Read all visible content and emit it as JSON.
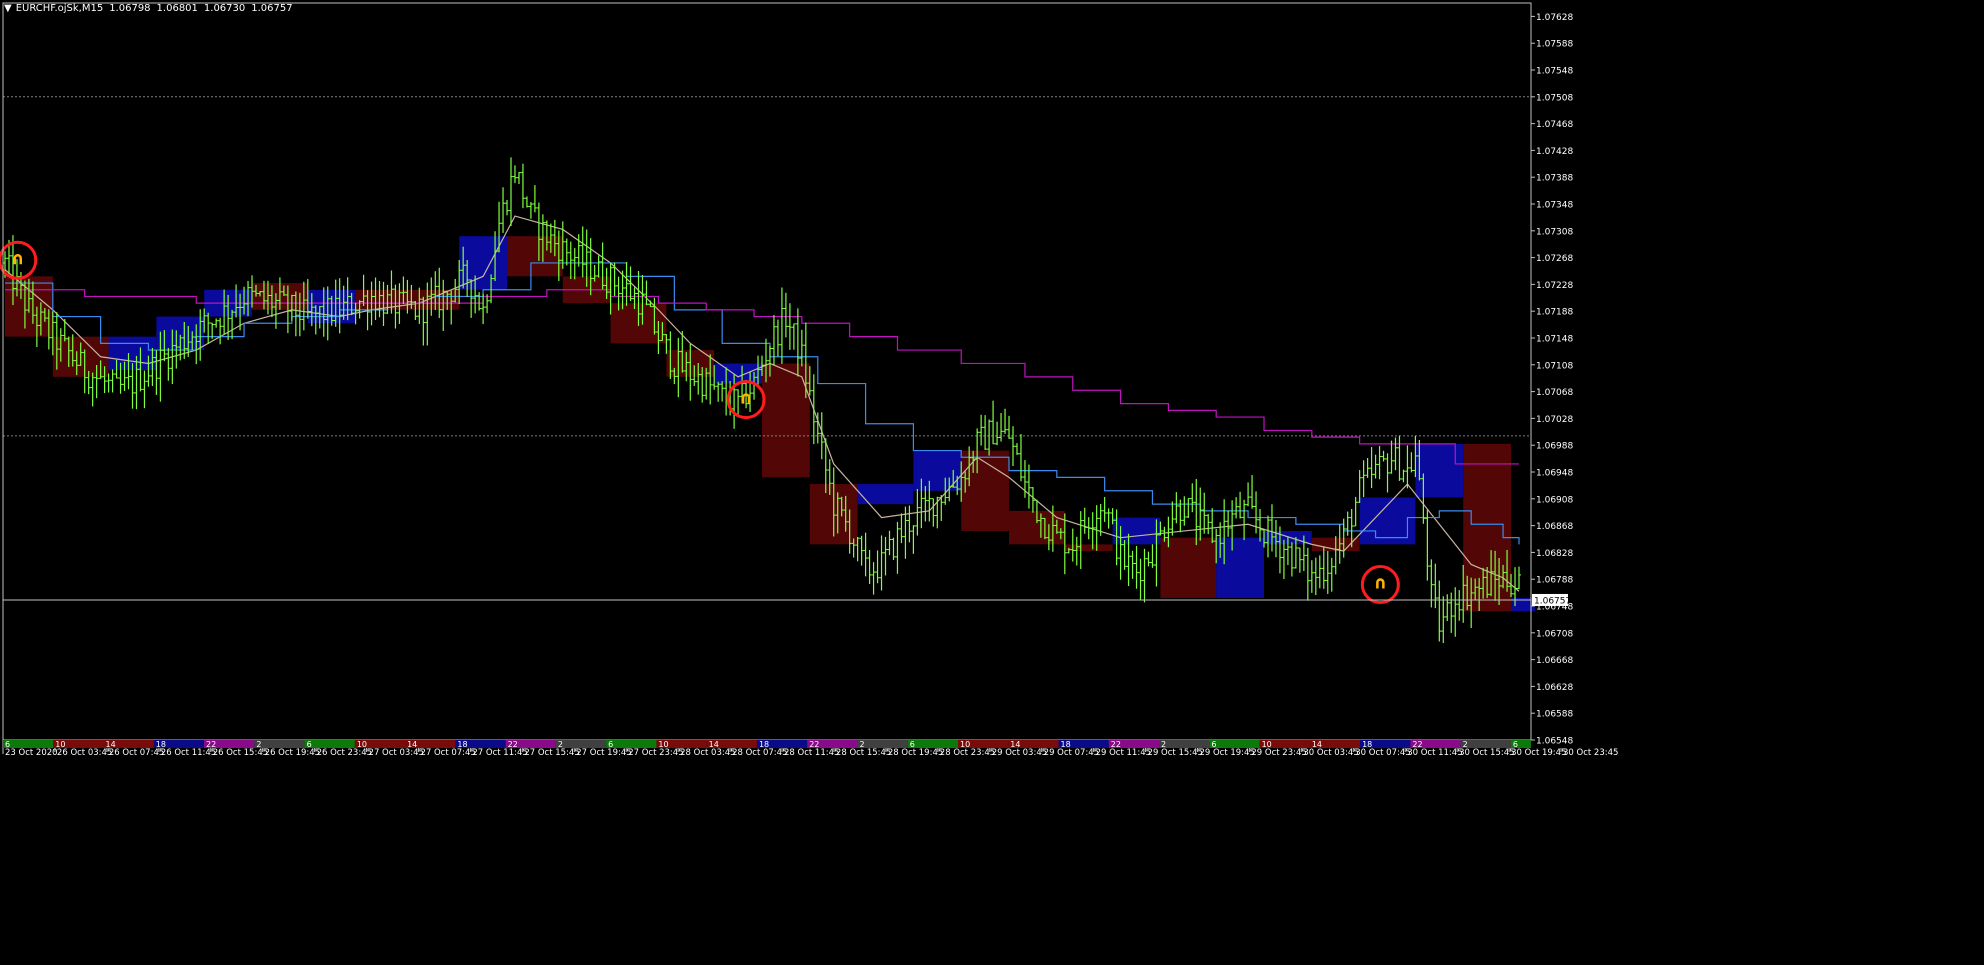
{
  "header": {
    "symbol": "EURCHF.ojSk,M15",
    "open": "1.06798",
    "high": "1.06801",
    "low": "1.06730",
    "close": "1.06757",
    "menu_icon": "triangle-down-icon"
  },
  "colors": {
    "background": "#000000",
    "frame": "#c0c0c0",
    "candle": "#7fff3f",
    "session_up": "#0a0a9c",
    "session_down": "#520606",
    "ma_fast": "#c8b4a0",
    "ma_mid": "#3a8cf0",
    "ma_slow": "#c012c0",
    "marker_circle": "#ff1c1c",
    "marker_icon": "#ffb400",
    "price_line": "#c0c0c0",
    "level_line": "#808080"
  },
  "chart_data": {
    "type": "candlestick",
    "symbol": "EURCHF.ojSk",
    "timeframe": "M15",
    "ylim": [
      1.06548,
      1.07648
    ],
    "y_ticks": [
      "1.07628",
      "1.07588",
      "1.07548",
      "1.07508",
      "1.07468",
      "1.07428",
      "1.07388",
      "1.07348",
      "1.07308",
      "1.07268",
      "1.07228",
      "1.07188",
      "1.07148",
      "1.07108",
      "1.07068",
      "1.07028",
      "1.06988",
      "1.06948",
      "1.06908",
      "1.06868",
      "1.06828",
      "1.06788",
      "1.06748",
      "1.06708",
      "1.06668",
      "1.06628",
      "1.06588",
      "1.06548"
    ],
    "x_ticks": [
      "23 Oct 2020",
      "26 Oct 03:45",
      "26 Oct 07:45",
      "26 Oct 11:45",
      "26 Oct 15:45",
      "26 Oct 19:45",
      "26 Oct 23:45",
      "27 Oct 03:45",
      "27 Oct 07:45",
      "27 Oct 11:45",
      "27 Oct 15:45",
      "27 Oct 19:45",
      "27 Oct 23:45",
      "28 Oct 03:45",
      "28 Oct 07:45",
      "28 Oct 11:45",
      "28 Oct 15:45",
      "28 Oct 19:45",
      "28 Oct 23:45",
      "29 Oct 03:45",
      "29 Oct 07:45",
      "29 Oct 11:45",
      "29 Oct 15:45",
      "29 Oct 19:45",
      "29 Oct 23:45",
      "30 Oct 03:45",
      "30 Oct 07:45",
      "30 Oct 11:45",
      "30 Oct 15:45",
      "30 Oct 19:45",
      "30 Oct 23:45"
    ],
    "current_price": "1.06757",
    "horizontal_levels": [
      1.07508,
      1.07002
    ],
    "price_path": [
      [
        0,
        1.0726
      ],
      [
        1.5,
        1.0719
      ],
      [
        3,
        1.0715
      ],
      [
        5,
        1.071
      ],
      [
        7,
        1.0707
      ],
      [
        8,
        1.0708
      ],
      [
        10,
        1.0712
      ],
      [
        12,
        1.0716
      ],
      [
        14,
        1.0719
      ],
      [
        15,
        1.0721
      ],
      [
        17,
        1.072
      ],
      [
        19,
        1.0718
      ],
      [
        21,
        1.0719
      ],
      [
        23,
        1.0721
      ],
      [
        24,
        1.072
      ],
      [
        26,
        1.0719
      ],
      [
        27.5,
        1.0721
      ],
      [
        29,
        1.0724
      ],
      [
        30,
        1.0719
      ],
      [
        31,
        1.0732
      ],
      [
        32,
        1.074
      ],
      [
        33,
        1.0733
      ],
      [
        34,
        1.073
      ],
      [
        35,
        1.0728
      ],
      [
        37,
        1.0725
      ],
      [
        39,
        1.0722
      ],
      [
        40,
        1.072
      ],
      [
        41,
        1.0715
      ],
      [
        42,
        1.0711
      ],
      [
        44,
        1.0708
      ],
      [
        45,
        1.0706
      ],
      [
        46,
        1.0705
      ],
      [
        47,
        1.0708
      ],
      [
        48,
        1.0714
      ],
      [
        49,
        1.0718
      ],
      [
        50,
        1.0712
      ],
      [
        51,
        1.07
      ],
      [
        52,
        1.069
      ],
      [
        53,
        1.0686
      ],
      [
        54,
        1.068
      ],
      [
        55,
        1.0681
      ],
      [
        56,
        1.0685
      ],
      [
        57,
        1.0688
      ],
      [
        58,
        1.069
      ],
      [
        59,
        1.0692
      ],
      [
        60,
        1.0694
      ],
      [
        61,
        1.0699
      ],
      [
        62,
        1.0701
      ],
      [
        63,
        1.07
      ],
      [
        64,
        1.0693
      ],
      [
        65,
        1.0688
      ],
      [
        66,
        1.0685
      ],
      [
        67,
        1.0684
      ],
      [
        68,
        1.0688
      ],
      [
        69,
        1.069
      ],
      [
        70,
        1.0682
      ],
      [
        71,
        1.068
      ],
      [
        72,
        1.0683
      ],
      [
        73,
        1.0688
      ],
      [
        74,
        1.069
      ],
      [
        75,
        1.0687
      ],
      [
        76,
        1.0685
      ],
      [
        77,
        1.0688
      ],
      [
        78,
        1.0689
      ],
      [
        79,
        1.0686
      ],
      [
        80,
        1.0684
      ],
      [
        81,
        1.0682
      ],
      [
        82,
        1.0679
      ],
      [
        83,
        1.0681
      ],
      [
        84,
        1.0685
      ],
      [
        85,
        1.0692
      ],
      [
        86,
        1.0695
      ],
      [
        87,
        1.0697
      ],
      [
        88,
        1.0695
      ],
      [
        88.5,
        1.0697
      ],
      [
        89,
        1.0688
      ],
      [
        89.5,
        1.0676
      ],
      [
        90,
        1.0672
      ],
      [
        91,
        1.0676
      ],
      [
        92,
        1.0677
      ],
      [
        93,
        1.0678
      ],
      [
        94,
        1.0679
      ],
      [
        95,
        1.0678
      ]
    ],
    "series": [
      {
        "name": "ma_fast",
        "points": [
          [
            0,
            1.0725
          ],
          [
            3,
            1.0719
          ],
          [
            6,
            1.0712
          ],
          [
            9,
            1.0711
          ],
          [
            12,
            1.0713
          ],
          [
            15,
            1.0717
          ],
          [
            18,
            1.0719
          ],
          [
            21,
            1.0718
          ],
          [
            23,
            1.0719
          ],
          [
            26,
            1.072
          ],
          [
            28,
            1.0722
          ],
          [
            30,
            1.0724
          ],
          [
            32,
            1.0733
          ],
          [
            35,
            1.0731
          ],
          [
            38,
            1.0726
          ],
          [
            41,
            1.0719
          ],
          [
            43,
            1.0714
          ],
          [
            46,
            1.0709
          ],
          [
            48,
            1.0711
          ],
          [
            50,
            1.0709
          ],
          [
            52,
            1.0696
          ],
          [
            55,
            1.0688
          ],
          [
            58,
            1.0689
          ],
          [
            61,
            1.0697
          ],
          [
            63,
            1.0694
          ],
          [
            66,
            1.0688
          ],
          [
            70,
            1.0685
          ],
          [
            74,
            1.0686
          ],
          [
            78,
            1.0687
          ],
          [
            82,
            1.0684
          ],
          [
            84,
            1.0683
          ],
          [
            86,
            1.0688
          ],
          [
            88,
            1.0693
          ],
          [
            90,
            1.0687
          ],
          [
            92,
            1.0681
          ],
          [
            94,
            1.0679
          ],
          [
            95,
            1.0677
          ]
        ]
      },
      {
        "name": "ma_mid",
        "points": [
          [
            0,
            1.0723
          ],
          [
            3,
            1.0718
          ],
          [
            6,
            1.0714
          ],
          [
            9,
            1.0713
          ],
          [
            12,
            1.0715
          ],
          [
            15,
            1.0717
          ],
          [
            18,
            1.0718
          ],
          [
            21,
            1.0719
          ],
          [
            24,
            1.072
          ],
          [
            27,
            1.0721
          ],
          [
            30,
            1.0722
          ],
          [
            33,
            1.0726
          ],
          [
            36,
            1.0726
          ],
          [
            39,
            1.0724
          ],
          [
            42,
            1.0719
          ],
          [
            45,
            1.0714
          ],
          [
            48,
            1.0712
          ],
          [
            51,
            1.0708
          ],
          [
            54,
            1.0702
          ],
          [
            57,
            1.0698
          ],
          [
            60,
            1.0697
          ],
          [
            63,
            1.0695
          ],
          [
            66,
            1.0694
          ],
          [
            69,
            1.0692
          ],
          [
            72,
            1.069
          ],
          [
            75,
            1.0689
          ],
          [
            78,
            1.0688
          ],
          [
            81,
            1.0687
          ],
          [
            84,
            1.0686
          ],
          [
            86,
            1.0685
          ],
          [
            88,
            1.0688
          ],
          [
            90,
            1.0689
          ],
          [
            92,
            1.0687
          ],
          [
            94,
            1.0685
          ],
          [
            95,
            1.0684
          ]
        ]
      },
      {
        "name": "ma_slow",
        "points": [
          [
            0,
            1.0722
          ],
          [
            5,
            1.0721
          ],
          [
            12,
            1.072
          ],
          [
            20,
            1.072
          ],
          [
            26,
            1.072
          ],
          [
            30,
            1.0721
          ],
          [
            34,
            1.0722
          ],
          [
            38,
            1.0721
          ],
          [
            41,
            1.072
          ],
          [
            44,
            1.0719
          ],
          [
            47,
            1.0718
          ],
          [
            50,
            1.0717
          ],
          [
            53,
            1.0715
          ],
          [
            56,
            1.0713
          ],
          [
            60,
            1.0711
          ],
          [
            64,
            1.0709
          ],
          [
            67,
            1.0707
          ],
          [
            70,
            1.0705
          ],
          [
            73,
            1.0704
          ],
          [
            76,
            1.0703
          ],
          [
            79,
            1.0701
          ],
          [
            82,
            1.07
          ],
          [
            85,
            1.0699
          ],
          [
            88,
            1.0699
          ],
          [
            91,
            1.0696
          ],
          [
            95,
            1.0696
          ]
        ]
      }
    ],
    "session_boxes": [
      {
        "x0": 0,
        "x1": 3,
        "top": 1.0724,
        "bottom": 1.0715,
        "dir": "down"
      },
      {
        "x0": 3,
        "x1": 6.5,
        "top": 1.0715,
        "bottom": 1.0709,
        "dir": "down"
      },
      {
        "x0": 6.5,
        "x1": 9.5,
        "top": 1.0715,
        "bottom": 1.071,
        "dir": "up"
      },
      {
        "x0": 9.5,
        "x1": 12.5,
        "top": 1.0718,
        "bottom": 1.0713,
        "dir": "up"
      },
      {
        "x0": 12.5,
        "x1": 15.5,
        "top": 1.0722,
        "bottom": 1.0718,
        "dir": "up"
      },
      {
        "x0": 15.5,
        "x1": 19,
        "top": 1.0723,
        "bottom": 1.0719,
        "dir": "down"
      },
      {
        "x0": 19,
        "x1": 22,
        "top": 1.0722,
        "bottom": 1.0717,
        "dir": "up"
      },
      {
        "x0": 22,
        "x1": 25,
        "top": 1.0722,
        "bottom": 1.0719,
        "dir": "down"
      },
      {
        "x0": 25,
        "x1": 28.5,
        "top": 1.0722,
        "bottom": 1.0719,
        "dir": "down"
      },
      {
        "x0": 28.5,
        "x1": 31.5,
        "top": 1.073,
        "bottom": 1.0722,
        "dir": "up"
      },
      {
        "x0": 31.5,
        "x1": 35,
        "top": 1.073,
        "bottom": 1.0724,
        "dir": "down"
      },
      {
        "x0": 35,
        "x1": 38,
        "top": 1.0724,
        "bottom": 1.072,
        "dir": "down"
      },
      {
        "x0": 38,
        "x1": 41.5,
        "top": 1.072,
        "bottom": 1.0714,
        "dir": "down"
      },
      {
        "x0": 41.5,
        "x1": 44.5,
        "top": 1.0713,
        "bottom": 1.0709,
        "dir": "down"
      },
      {
        "x0": 44.5,
        "x1": 47.5,
        "top": 1.0711,
        "bottom": 1.0708,
        "dir": "up"
      },
      {
        "x0": 47.5,
        "x1": 50.5,
        "top": 1.0711,
        "bottom": 1.0694,
        "dir": "down"
      },
      {
        "x0": 50.5,
        "x1": 53.5,
        "top": 1.0693,
        "bottom": 1.0684,
        "dir": "down"
      },
      {
        "x0": 53.5,
        "x1": 57,
        "top": 1.0693,
        "bottom": 1.069,
        "dir": "up"
      },
      {
        "x0": 57,
        "x1": 60,
        "top": 1.0698,
        "bottom": 1.0692,
        "dir": "up"
      },
      {
        "x0": 60,
        "x1": 63,
        "top": 1.0698,
        "bottom": 1.0686,
        "dir": "down"
      },
      {
        "x0": 63,
        "x1": 66.5,
        "top": 1.0689,
        "bottom": 1.0684,
        "dir": "down"
      },
      {
        "x0": 66.5,
        "x1": 69.5,
        "top": 1.0684,
        "bottom": 1.0683,
        "dir": "down"
      },
      {
        "x0": 69.5,
        "x1": 72.5,
        "top": 1.0688,
        "bottom": 1.0684,
        "dir": "up"
      },
      {
        "x0": 72.5,
        "x1": 76,
        "top": 1.0685,
        "bottom": 1.0676,
        "dir": "down"
      },
      {
        "x0": 76,
        "x1": 79,
        "top": 1.0685,
        "bottom": 1.0676,
        "dir": "up"
      },
      {
        "x0": 79,
        "x1": 82,
        "top": 1.0686,
        "bottom": 1.0684,
        "dir": "up"
      },
      {
        "x0": 82,
        "x1": 85,
        "top": 1.0685,
        "bottom": 1.0683,
        "dir": "down"
      },
      {
        "x0": 85,
        "x1": 88.5,
        "top": 1.0691,
        "bottom": 1.0684,
        "dir": "up"
      },
      {
        "x0": 88.5,
        "x1": 91.5,
        "top": 1.0699,
        "bottom": 1.0691,
        "dir": "up"
      },
      {
        "x0": 91.5,
        "x1": 94.5,
        "top": 1.0699,
        "bottom": 1.0674,
        "dir": "down"
      },
      {
        "x0": 94.5,
        "x1": 96,
        "top": 1.0676,
        "bottom": 1.0674,
        "dir": "up"
      }
    ],
    "markers": [
      {
        "x": 0.8,
        "price": 1.07264
      },
      {
        "x": 46.5,
        "price": 1.07056
      },
      {
        "x": 86.3,
        "price": 1.0678
      }
    ],
    "session_strip": [
      "6",
      "10",
      "14",
      "18",
      "22",
      "2",
      "6",
      "10",
      "14",
      "18",
      "22",
      "2",
      "6",
      "10",
      "14",
      "18",
      "22",
      "2",
      "6",
      "10",
      "14",
      "18",
      "22",
      "2",
      "6",
      "10",
      "14",
      "18",
      "22",
      "2",
      "6"
    ]
  }
}
